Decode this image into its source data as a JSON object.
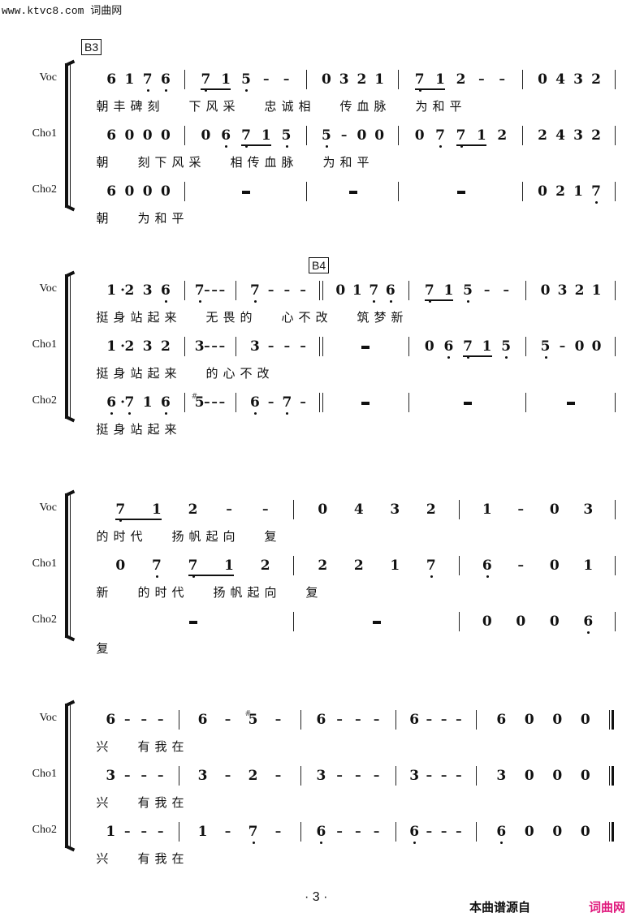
{
  "watermark": "www.ktvc8.com 词曲网",
  "parts": [
    "Voc",
    "Cho1",
    "Cho2"
  ],
  "rehearsal_marks": [
    "B3",
    "B4"
  ],
  "systems": [
    {
      "rehearsal": "B3",
      "measures_text": {
        "Voc": [
          "6 1 7̣ 6̣",
          "7̣1 5̣ – –",
          "0 3 2 1",
          "7̣1 2 – –",
          "0 4 3 2"
        ],
        "Cho1": [
          "6 0 0 0",
          "0 6̣ 7̣1 5̣",
          "5̣ – 0 0",
          "0 7̣ 7̣1 2",
          "2 4 3 2"
        ],
        "Cho2": [
          "6 0 0 0",
          "rest",
          "rest",
          "rest",
          "0 2 1 7̣"
        ]
      },
      "lyrics": {
        "Voc": "朝丰碑刻 下风采 忠诚相 传血脉 为和平",
        "Cho1": "朝 刻下风采 相传血脉 为和平",
        "Cho2": "朝 为和平"
      }
    },
    {
      "rehearsal": "B4",
      "measures_text": {
        "Voc": [
          "1· 2 3 6̣",
          "7̣ – – –",
          "7̣ – – –",
          "0 1 7̣ 6̣",
          "7̣1 5̣ – –",
          "0 3 2 1"
        ],
        "Cho1": [
          "1· 2 3 2",
          "3 – – –",
          "3 – – –",
          "rest",
          "0 6̣ 7̣1 5̣",
          "5̣ – 0 0"
        ],
        "Cho2": [
          "6̣· 7̣ 1 6̣",
          "#5 – – –",
          "6̣ – 7̣ –",
          "rest",
          "rest",
          "rest"
        ]
      },
      "lyrics": {
        "Voc": "挺身站起来 无畏的 心不改 筑梦新",
        "Cho1": "挺身站起来 的心不改",
        "Cho2": "挺身站起来"
      }
    },
    {
      "measures_text": {
        "Voc": [
          "7̣1 2 – –",
          "0 4 3 2",
          "1 – 0 3"
        ],
        "Cho1": [
          "0 7̣ 7̣1 2",
          "2 2 1 7̣",
          "6̣ – 0 1"
        ],
        "Cho2": [
          "rest",
          "rest",
          "0 0 0 6̣"
        ]
      },
      "lyrics": {
        "Voc": "的时代 扬帆起向 复",
        "Cho1": "新 的时代 扬帆起向 复",
        "Cho2": "复"
      }
    },
    {
      "measures_text": {
        "Voc": [
          "6 – – –",
          "6 – #5 –",
          "6 – – –",
          "6 – – –",
          "6 0 0 0"
        ],
        "Cho1": [
          "3 – – –",
          "3 – 2 –",
          "3 – – –",
          "3 – – –",
          "3 0 0 0"
        ],
        "Cho2": [
          "1 – – –",
          "1 – 7̣ –",
          "6̣ – – –",
          "6̣ – – –",
          "6̣ 0 0 0"
        ]
      },
      "lyrics": {
        "Voc": "兴 有我在",
        "Cho1": "兴 有我在",
        "Cho2": "兴 有我在"
      }
    }
  ],
  "footer": {
    "page_number": "· 3 ·",
    "source_label": "本曲谱源自",
    "source_site": "词曲网"
  }
}
